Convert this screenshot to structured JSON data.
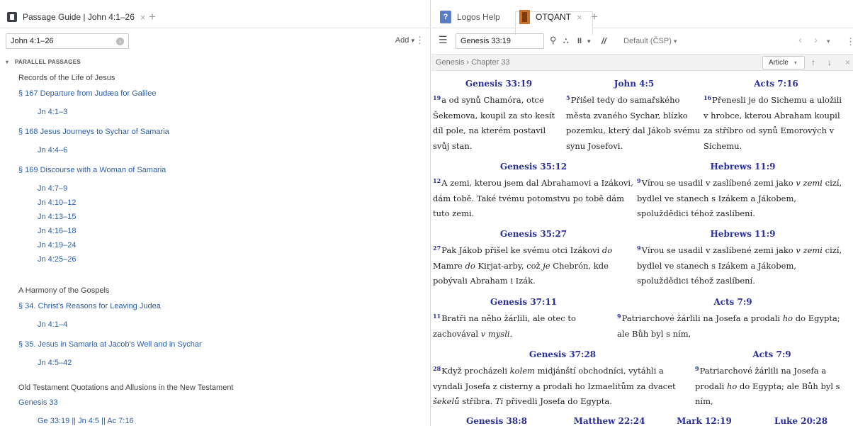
{
  "left": {
    "tab": {
      "title": "Passage Guide | John 4:1–26",
      "close": "×",
      "add": "+"
    },
    "toolbar": {
      "reference": "John 4:1–26",
      "go": "›",
      "add_label": "Add",
      "add_caret": "▾",
      "menu": "⋮"
    },
    "section": {
      "toggle": "▾",
      "title": "PARALLEL PASSAGES"
    },
    "rows": [
      {
        "text": "Records of the Life of Jesus",
        "kind": "head",
        "indent": 1
      },
      {
        "text": "§ 167 Departure from Judæa for Galilee",
        "kind": "link",
        "indent": 1
      },
      {
        "text": "Jn 4:1–3",
        "kind": "link",
        "indent": 2
      },
      {
        "text": "§ 168 Jesus Journeys to Sychar of Samaria",
        "kind": "link",
        "indent": 1
      },
      {
        "text": "Jn 4:4–6",
        "kind": "link",
        "indent": 2
      },
      {
        "text": "§ 169 Discourse with a Woman of Samaria",
        "kind": "link",
        "indent": 1
      },
      {
        "text": "Jn 4:7–9",
        "kind": "link",
        "indent": 2
      },
      {
        "text": "Jn 4:10–12",
        "kind": "link",
        "indent": 2
      },
      {
        "text": "Jn 4:13–15",
        "kind": "link",
        "indent": 2
      },
      {
        "text": "Jn 4:16–18",
        "kind": "link",
        "indent": 2
      },
      {
        "text": "Jn 4:19–24",
        "kind": "link",
        "indent": 2
      },
      {
        "text": "Jn 4:25–26",
        "kind": "link",
        "indent": 2
      },
      {
        "text": "A Harmony of the Gospels",
        "kind": "head",
        "indent": 1
      },
      {
        "text": "§ 34. Christ's Reasons for Leaving Judea",
        "kind": "link",
        "indent": 1
      },
      {
        "text": "Jn 4:1–4",
        "kind": "link",
        "indent": 2
      },
      {
        "text": "§ 35. Jesus in Samaria at Jacob's Well and in Sychar",
        "kind": "link",
        "indent": 1
      },
      {
        "text": "Jn 4:5–42",
        "kind": "link",
        "indent": 2
      },
      {
        "text": "Old Testament Quotations and Allusions in the New Testament",
        "kind": "head",
        "indent": 1
      },
      {
        "text": "Genesis 33",
        "kind": "link",
        "indent": 1
      },
      {
        "text": "Ge 33:19 || Jn 4:5 || Ac 7:16",
        "kind": "link",
        "indent": 2
      }
    ]
  },
  "right": {
    "tabs": {
      "help": "Logos Help",
      "active": "OTQANT",
      "close": "×",
      "add": "+"
    },
    "toolbar": {
      "menu": "☰",
      "reference": "Genesis 33:19",
      "search": "⚲",
      "dots": "∴",
      "parallel": "II",
      "caret": "▾",
      "slashes": "//",
      "default": "Default (ČSP)",
      "default_caret": "▾",
      "back": "‹",
      "fwd": "›",
      "nav_caret": "▾",
      "more": "⋮"
    },
    "crumb": {
      "text": "Genesis › Chapter 33",
      "article": "Article",
      "article_caret": "▾",
      "up": "↑",
      "down": "↓",
      "x": "×"
    },
    "groups": [
      {
        "ref": "Genesis 33:19",
        "verse": "19",
        "html": "a od synů Chamóra, otce Šekemova, koupil za sto kesít díl pole, na kterém postavil svůj stan."
      },
      {
        "ref": "John 4:5",
        "verse": "5",
        "html": "Přišel tedy do samařského města zvaného Sychar, blízko pozemku, který dal Jákob svému synu Josefovi."
      },
      {
        "ref": "Acts 7:16",
        "verse": "16",
        "html": "Přenesli je do Sichemu a uložili v hrobce, kterou Abraham koupil za stříbro od synů Emorových v Sichemu."
      },
      {
        "ref": "Genesis 35:12",
        "verse": "12",
        "html": "A zemi, kterou jsem dal Abrahamovi a Izákovi, dám tobě. Také tvému potomstvu po tobě dám tuto zemi."
      },
      {
        "ref": "Hebrews 11:9",
        "verse": "9",
        "html": "Vírou se usadil v zaslíbené zemi jako <em>v zemi</em> cizí, bydlel ve stanech s Izákem a Jákobem, spoluždědici téhož zaslíbení."
      },
      {
        "ref": "Genesis 35:27",
        "verse": "27",
        "html": "Pak Jákob přišel ke svému otci Izákovi <em>do</em> Mamre <em>do</em> Kirjat-arby, což <em>je</em> Chebrón, kde pobývali Abraham i Izák."
      },
      {
        "ref": "Hebrews 11:9",
        "verse": "9",
        "html": "Vírou se usadil v zaslíbené zemi jako <em>v zemi</em> cizí, bydlel ve stanech s Izákem a Jákobem, spoluždědici téhož zaslíbení."
      },
      {
        "ref": "Genesis 37:11",
        "verse": "11",
        "html": "Bratři na něho žárlili, ale otec to zachovával <em>v mysli</em>."
      },
      {
        "ref": "Acts 7:9",
        "verse": "9",
        "html": "Patriarchové žárlili na Josefa a prodali <em>ho</em> do Egypta; ale Bůh byl s ním,"
      },
      {
        "ref": "Genesis 37:28",
        "verse": "28",
        "html": "Když procházeli <em>kolem</em> midjánští obchodníci, vytáhli a vyndali Josefa z cisterny a prodali ho Izmaelitům za dvacet <em>šekelů</em> stříbra. <em>Ti</em> přivedli Josefa do Egypta."
      },
      {
        "ref": "Acts 7:9",
        "verse": "9",
        "html": "Patriarchové žárlili na Josefa a prodali <em>ho</em> do Egypta; ale Bůh byl s ním,"
      },
      {
        "ref": "Genesis 38:8",
        "verse": "",
        "html": ""
      },
      {
        "ref": "Matthew 22:24",
        "verse": "",
        "html": ""
      },
      {
        "ref": "Mark 12:19",
        "verse": "",
        "html": ""
      },
      {
        "ref": "Luke 20:28",
        "verse": "",
        "html": ""
      }
    ]
  }
}
